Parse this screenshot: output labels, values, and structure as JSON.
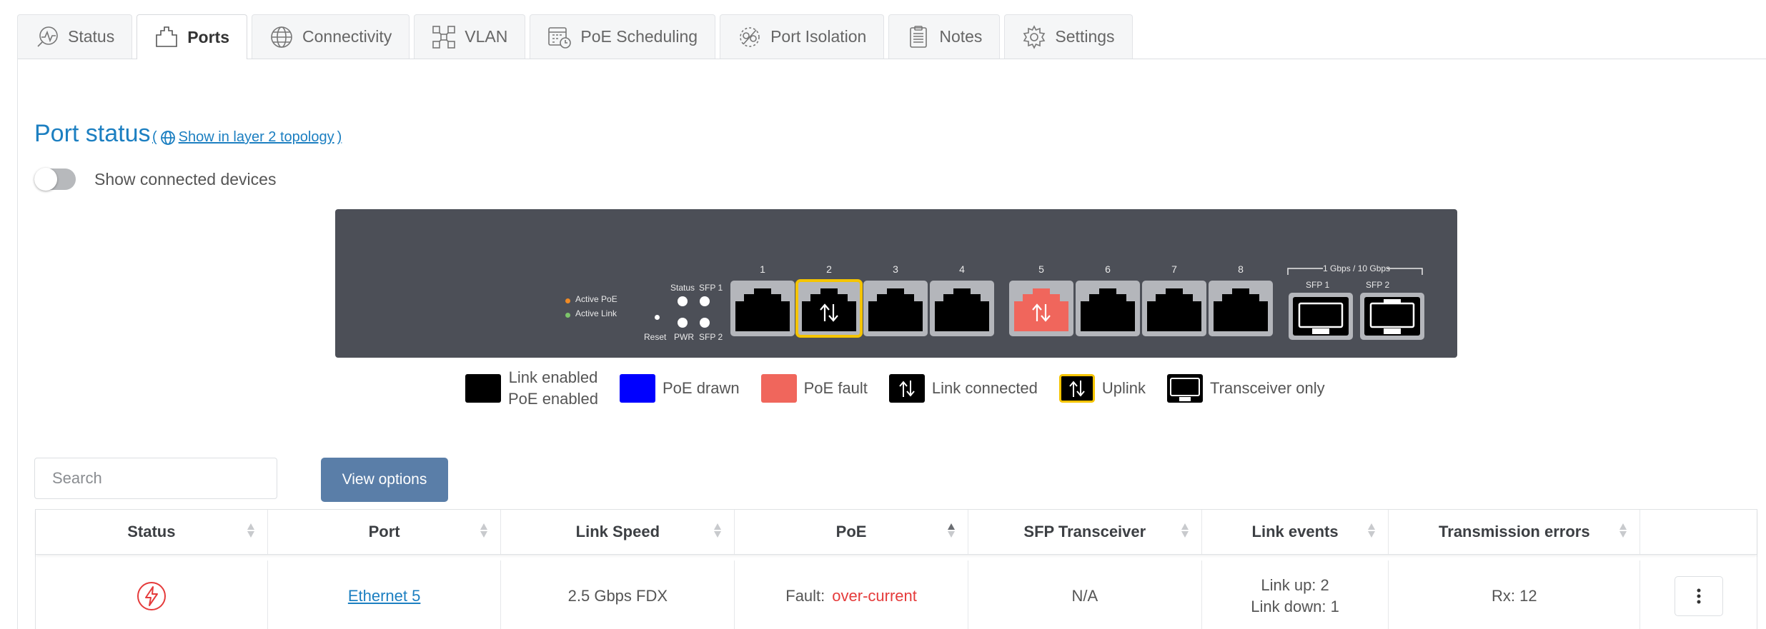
{
  "tabs": [
    {
      "label": "Status",
      "icon": "status-pulse-icon"
    },
    {
      "label": "Ports",
      "icon": "port-icon",
      "active": true
    },
    {
      "label": "Connectivity",
      "icon": "globe-icon"
    },
    {
      "label": "VLAN",
      "icon": "vlan-icon"
    },
    {
      "label": "PoE Scheduling",
      "icon": "calendar-clock-icon"
    },
    {
      "label": "Port Isolation",
      "icon": "isolation-icon"
    },
    {
      "label": "Notes",
      "icon": "notes-icon"
    },
    {
      "label": "Settings",
      "icon": "gear-icon"
    }
  ],
  "header": {
    "title": "Port status",
    "topology_link": "Show in layer 2 topology",
    "show_connected_label": "Show connected devices",
    "show_connected_on": false
  },
  "faceplate": {
    "legend_poe": "Active PoE",
    "legend_link": "Active Link",
    "status_label": "Status",
    "sfp1_label": "SFP 1",
    "reset_label": "Reset",
    "pwr_label": "PWR",
    "sfp2_label": "SFP 2",
    "sfp_speed_label": "1 Gbps / 10 Gbps",
    "ports": [
      {
        "num": "1",
        "state": "enabled"
      },
      {
        "num": "2",
        "state": "uplink"
      },
      {
        "num": "3",
        "state": "enabled"
      },
      {
        "num": "4",
        "state": "enabled"
      },
      {
        "num": "5",
        "state": "poe-fault"
      },
      {
        "num": "6",
        "state": "enabled"
      },
      {
        "num": "7",
        "state": "enabled"
      },
      {
        "num": "8",
        "state": "enabled"
      }
    ],
    "sfp_ports": [
      {
        "label": "SFP 1"
      },
      {
        "label": "SFP 2"
      }
    ]
  },
  "legend": {
    "link_enabled": "Link enabled",
    "poe_enabled": "PoE enabled",
    "poe_drawn": "PoE drawn",
    "poe_fault": "PoE fault",
    "link_connected": "Link connected",
    "uplink": "Uplink",
    "transceiver_only": "Transceiver only"
  },
  "colors": {
    "accent": "#1c7fc1",
    "poe_drawn": "#0000ff",
    "poe_fault": "#f0665c",
    "uplink": "#f5c400",
    "fault_text": "#e53b3b"
  },
  "search": {
    "placeholder": "Search",
    "value": ""
  },
  "view_options_label": "View options",
  "table": {
    "columns": [
      "Status",
      "Port",
      "Link Speed",
      "PoE",
      "SFP Transceiver",
      "Link events",
      "Transmission errors",
      ""
    ],
    "rows": [
      {
        "status_icon": "lightning-fault-icon",
        "port": "Ethernet 5",
        "link_speed": "2.5 Gbps FDX",
        "poe_prefix": "Fault:",
        "poe_fault": "over-current",
        "sfp": "N/A",
        "link_up": "Link up: 2",
        "link_down": "Link down: 1",
        "tx_errors": "Rx: 12"
      }
    ]
  }
}
